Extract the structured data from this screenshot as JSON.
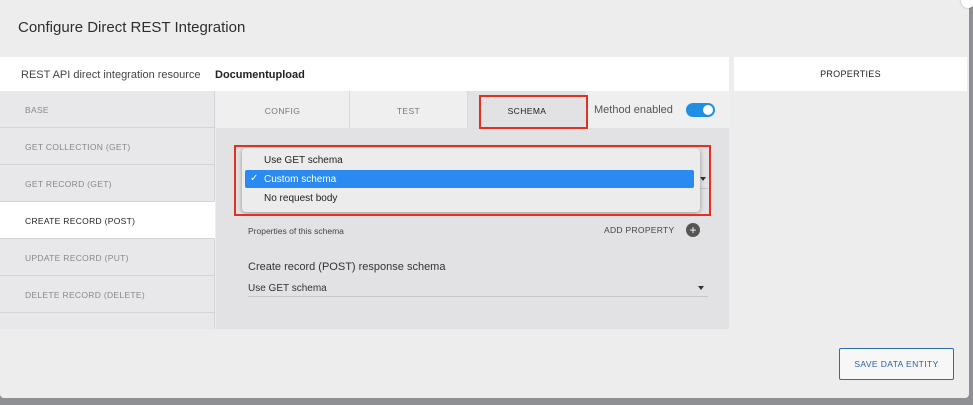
{
  "modal": {
    "title": "Configure Direct REST Integration"
  },
  "resource": {
    "label": "REST API direct integration resource",
    "value": "Documentupload"
  },
  "properties_panel": {
    "title": "PROPERTIES"
  },
  "sidebar": {
    "items": [
      {
        "label": "BASE",
        "active": false
      },
      {
        "label": "GET COLLECTION (GET)",
        "active": false
      },
      {
        "label": "GET RECORD (GET)",
        "active": false
      },
      {
        "label": "CREATE RECORD (POST)",
        "active": true
      },
      {
        "label": "UPDATE RECORD (PUT)",
        "active": false
      },
      {
        "label": "DELETE RECORD (DELETE)",
        "active": false
      }
    ]
  },
  "tabs": {
    "items": [
      {
        "label": "CONFIG"
      },
      {
        "label": "TEST"
      },
      {
        "label": "SCHEMA",
        "active": true
      }
    ],
    "method_enabled_label": "Method enabled",
    "method_enabled": true
  },
  "schema": {
    "request_dropdown_options": [
      {
        "label": "Use GET schema",
        "selected": false
      },
      {
        "label": "Custom schema",
        "selected": true
      },
      {
        "label": "No request body",
        "selected": false
      }
    ],
    "properties_label": "Properties of this schema",
    "add_property_label": "ADD PROPERTY",
    "response_title": "Create record (POST) response schema",
    "response_value": "Use GET schema"
  },
  "footer": {
    "save_label": "SAVE DATA ENTITY"
  },
  "colors": {
    "accent": "#2a8af2",
    "highlight": "#e0321e",
    "button_border": "#2a6bb8"
  }
}
